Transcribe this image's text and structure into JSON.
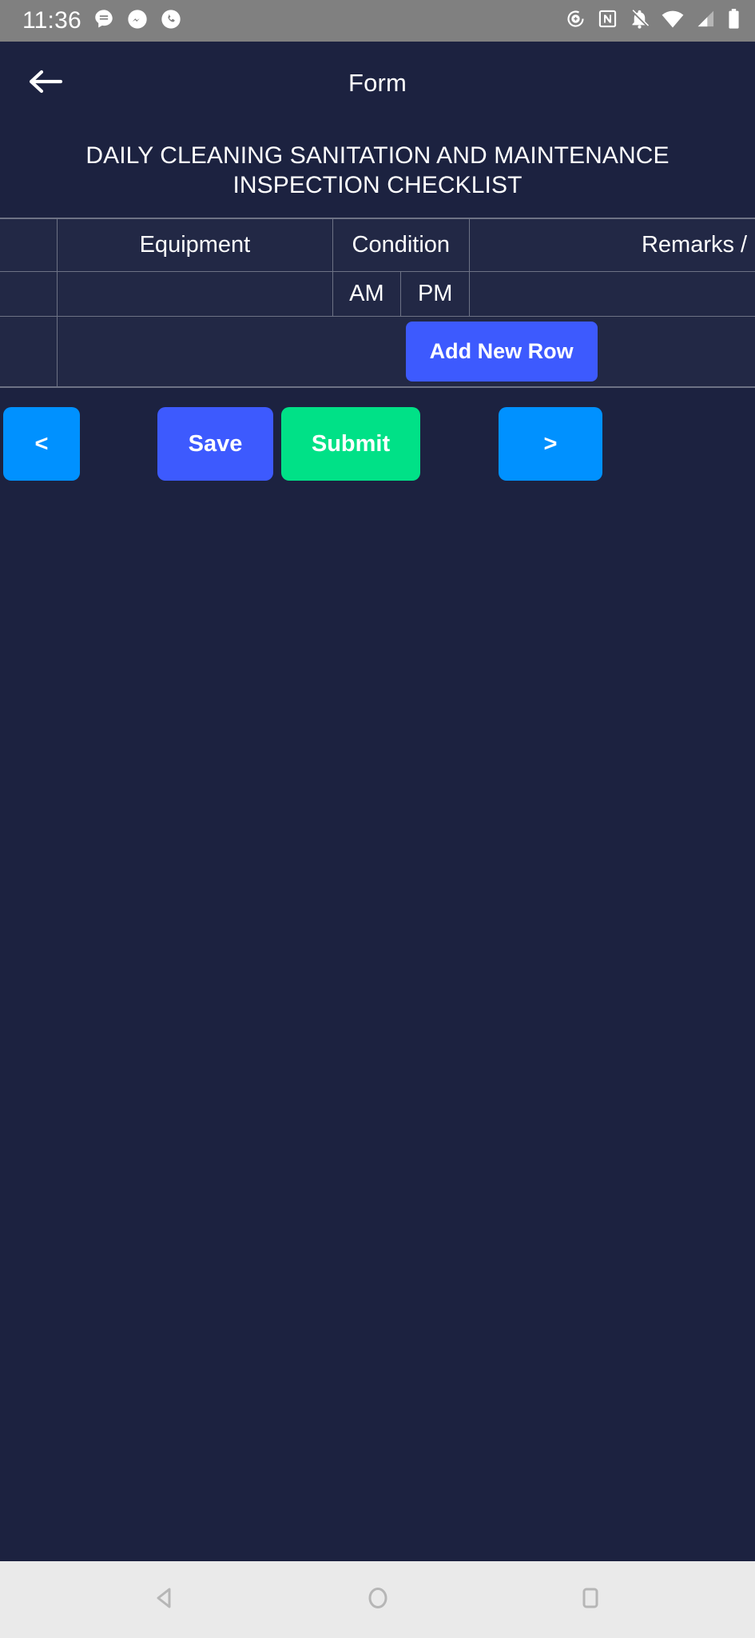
{
  "status_bar": {
    "time": "11:36",
    "left_icons": [
      "messages-icon",
      "messenger-icon",
      "phone-icon"
    ],
    "right_icons": [
      "data-saver-icon",
      "nfc-icon",
      "notifications-muted-icon",
      "wifi-icon",
      "cellular-signal-icon",
      "battery-icon"
    ],
    "background_color": "#808080",
    "foreground_color": "#ffffff"
  },
  "app_bar": {
    "back_label": "back-arrow",
    "title": "Form",
    "background_color": "#1c2240"
  },
  "form": {
    "heading_line1": "DAILY CLEANING SANITATION AND MAINTENANCE",
    "heading_line2": "INSPECTION CHECKLIST",
    "heading_full": "DAILY CLEANING SANITATION AND MAINTENANCE INSPECTION CHECKLIST"
  },
  "table": {
    "header_row_1": {
      "index": "",
      "equipment": "Equipment",
      "condition": "Condition",
      "remarks": "Remarks / R"
    },
    "header_row_2": {
      "index": "",
      "equipment": "",
      "am": "AM",
      "pm": "PM",
      "remarks": ""
    },
    "add_row_button": "Add New Row",
    "rows": []
  },
  "actions": {
    "prev_label": "<",
    "save_label": "Save",
    "submit_label": "Submit",
    "next_label": ">",
    "prev_color": "#0091ff",
    "save_color": "#3d5afe",
    "submit_color": "#00e187",
    "next_color": "#0091ff"
  },
  "nav_bar": {
    "back": "nav-back-icon",
    "home": "nav-home-icon",
    "recents": "nav-recents-icon",
    "background_color": "#eaeaea"
  }
}
